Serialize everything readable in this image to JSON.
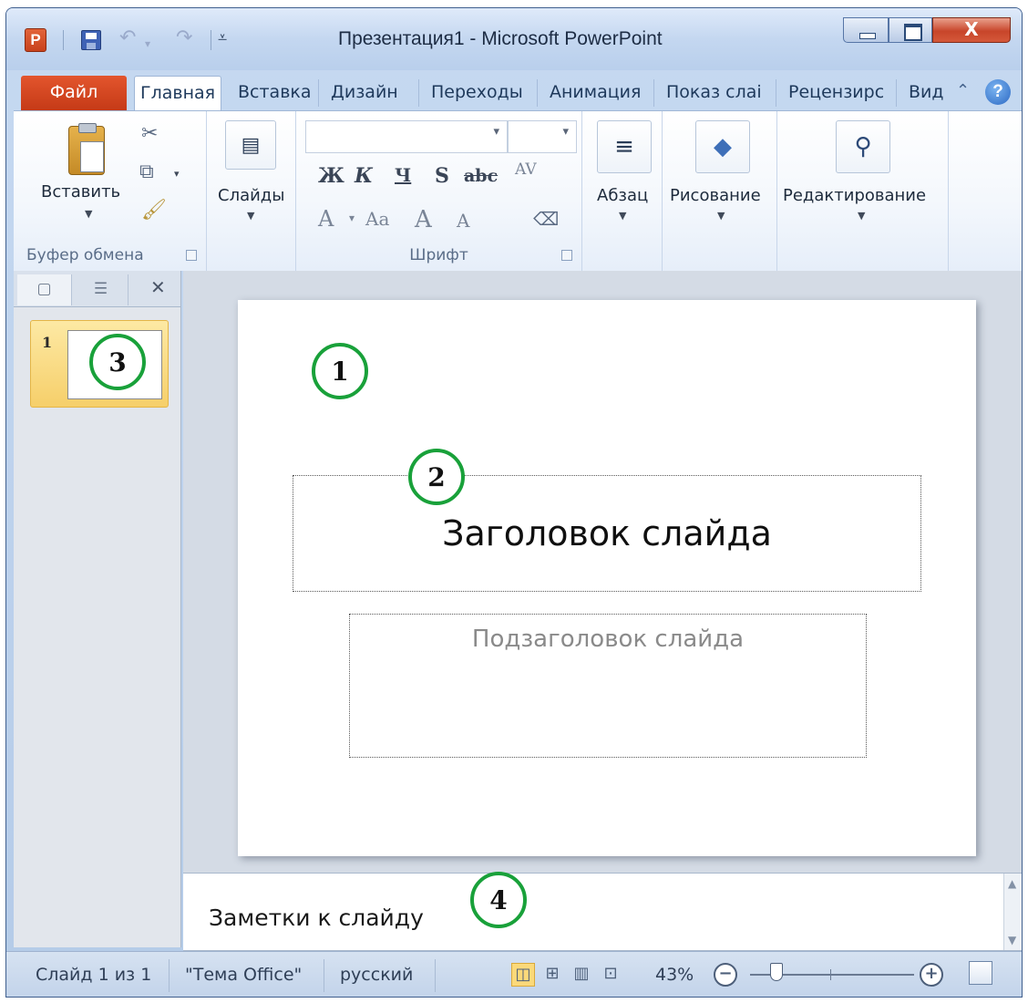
{
  "window": {
    "title": "Презентация1 - Microsoft PowerPoint",
    "app_icon_letter": "P",
    "close_glyph": "X"
  },
  "tabs": [
    {
      "label": "Файл"
    },
    {
      "label": "Главная"
    },
    {
      "label": "Вставка"
    },
    {
      "label": "Дизайн"
    },
    {
      "label": "Переходы"
    },
    {
      "label": "Анимация"
    },
    {
      "label": "Показ слаі"
    },
    {
      "label": "Рецензирс"
    },
    {
      "label": "Вид"
    }
  ],
  "ribbon": {
    "clipboard": {
      "paste_label": "Вставить",
      "group_label": "Буфер обмена"
    },
    "slides": {
      "label": "Слайды"
    },
    "font": {
      "group_label": "Шрифт",
      "bold": "Ж",
      "italic": "К",
      "underline": "Ч",
      "shadow": "S",
      "strike": "abc",
      "spacing": "AV",
      "font_color": "A",
      "case": "Aa",
      "grow": "A",
      "shrink": "A"
    },
    "paragraph": {
      "label": "Абзац"
    },
    "drawing": {
      "label": "Рисование"
    },
    "editing": {
      "label": "Редактирование"
    }
  },
  "slides_pane": {
    "slide_number": "1"
  },
  "slide": {
    "title_placeholder": "Заголовок слайда",
    "subtitle_placeholder": "Подзаголовок слайда"
  },
  "notes": {
    "placeholder": "Заметки к слайду"
  },
  "status": {
    "slide_info": "Слайд 1 из 1",
    "theme": "\"Тема Office\"",
    "language": "русский",
    "zoom": "43%",
    "zoom_level_percent": 43
  },
  "callouts": [
    "1",
    "2",
    "3",
    "4"
  ],
  "colors": {
    "file_tab": "#c53a17",
    "callout_ring": "#19a13a",
    "selected_thumb": "#f6cf6a"
  }
}
